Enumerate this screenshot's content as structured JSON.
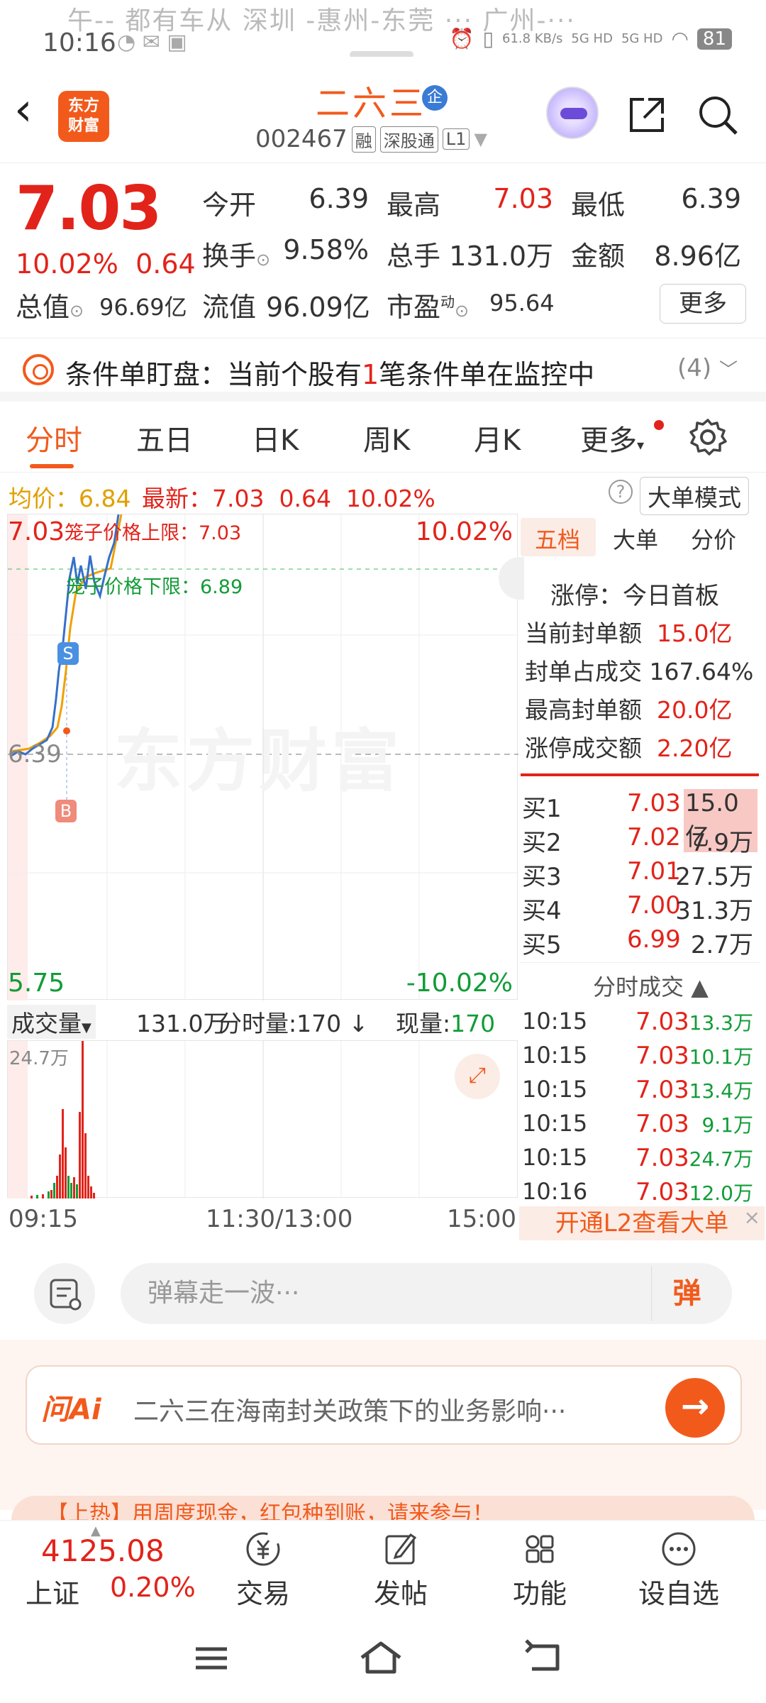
{
  "status_bar": {
    "ticker": "午-- 都有车从 深圳 -惠州-东莞 ··· 广州-··· ",
    "time": "10:16",
    "net_speed": "61.8 KB/s",
    "signal1": "5G HD",
    "signal2": "5G HD",
    "battery": "81"
  },
  "header": {
    "back_icon": "chevron-left-icon",
    "logo_line1": "东方",
    "logo_line2": "财富",
    "stock_name": "二六三",
    "enterprise_badge": "企",
    "stock_code": "002467",
    "tags": [
      "融",
      "深股通",
      "L1"
    ]
  },
  "quote": {
    "last_price": "7.03",
    "change_pct": "10.02%",
    "change_amt": "0.64",
    "open_label": "今开",
    "open": "6.39",
    "high_label": "最高",
    "high": "7.03",
    "low_label": "最低",
    "low": "6.39",
    "turnover_label": "换手",
    "turnover": "9.58%",
    "volume_label": "总手",
    "volume": "131.0万",
    "amount_label": "金额",
    "amount": "8.96亿",
    "mktcap_label": "总值",
    "mktcap": "96.69亿",
    "float_label": "流值",
    "float_cap": "96.09亿",
    "pe_label": "市盈",
    "pe_sup": "动",
    "pe": "95.64",
    "more_label": "更多"
  },
  "condition": {
    "text_before": "条件单盯盘：当前个股有",
    "count": "1",
    "text_after": "笔条件单在监控中",
    "badge": "(4)"
  },
  "tabs": [
    "分时",
    "五日",
    "日K",
    "周K",
    "月K",
    "更多"
  ],
  "avg_row": {
    "avg_label": "均价：",
    "avg": "6.84",
    "latest_label": "最新：",
    "latest": "7.03",
    "chg": "0.64",
    "pct": "10.02%",
    "mode_label": "大单模式"
  },
  "chart": {
    "top_price": "7.03",
    "top_pct": "10.02%",
    "upper_limit_label": "笼子价格上限：7.03",
    "lower_limit_label": "笼子价格下限：6.89",
    "ref_price": "6.39",
    "bottom_price": "5.75",
    "bottom_pct": "-10.02%",
    "watermark": "东方财富",
    "sell_marker": "S",
    "buy_marker": "B"
  },
  "volume": {
    "label": "成交量",
    "total": "131.0万",
    "tick_label": "分时量:170",
    "now_label": "现量:",
    "now": "170",
    "axis_max": "24.7万"
  },
  "time_axis": [
    "09:15",
    "11:30/13:00",
    "15:00"
  ],
  "right_panel": {
    "tabs": [
      "五档",
      "大单",
      "分价"
    ],
    "limit_title": "涨停：今日首板",
    "stats": [
      {
        "label": "当前封单额",
        "value": "15.0亿"
      },
      {
        "label": "封单占成交",
        "value": "167.64%"
      },
      {
        "label": "最高封单额",
        "value": "20.0亿"
      },
      {
        "label": "涨停成交额",
        "value": "2.20亿"
      }
    ],
    "order_book": [
      {
        "label": "买1",
        "price": "7.03",
        "vol": "15.0亿"
      },
      {
        "label": "买2",
        "price": "7.02",
        "vol": "7.9万"
      },
      {
        "label": "买3",
        "price": "7.01",
        "vol": "27.5万"
      },
      {
        "label": "买4",
        "price": "7.00",
        "vol": "31.3万"
      },
      {
        "label": "买5",
        "price": "6.99",
        "vol": "2.7万"
      }
    ],
    "trades_title": "分时成交",
    "trades": [
      {
        "time": "10:15",
        "price": "7.03",
        "vol": "13.3万"
      },
      {
        "time": "10:15",
        "price": "7.03",
        "vol": "10.1万"
      },
      {
        "time": "10:15",
        "price": "7.03",
        "vol": "13.4万"
      },
      {
        "time": "10:15",
        "price": "7.03",
        "vol": "9.1万"
      },
      {
        "time": "10:15",
        "price": "7.03",
        "vol": "24.7万"
      },
      {
        "time": "10:16",
        "price": "7.03",
        "vol": "12.0万"
      }
    ],
    "l2_banner": "开通L2查看大单"
  },
  "comment": {
    "placeholder": "弹幕走一波···",
    "send_label": "弹"
  },
  "ai": {
    "logo": "问Ai",
    "question": "二六三在海南封关政策下的业务影响···"
  },
  "ad_text": "【上热】用周度现金，红包种到账，请来参与！",
  "bottom_nav": {
    "index_value": "4125.08",
    "index_name": "上证",
    "index_change": "0.20%",
    "items": [
      "交易",
      "发帖",
      "功能",
      "设自选"
    ]
  },
  "colors": {
    "up": "#e2231a",
    "down": "#119c37",
    "brand": "#f25a1c"
  }
}
